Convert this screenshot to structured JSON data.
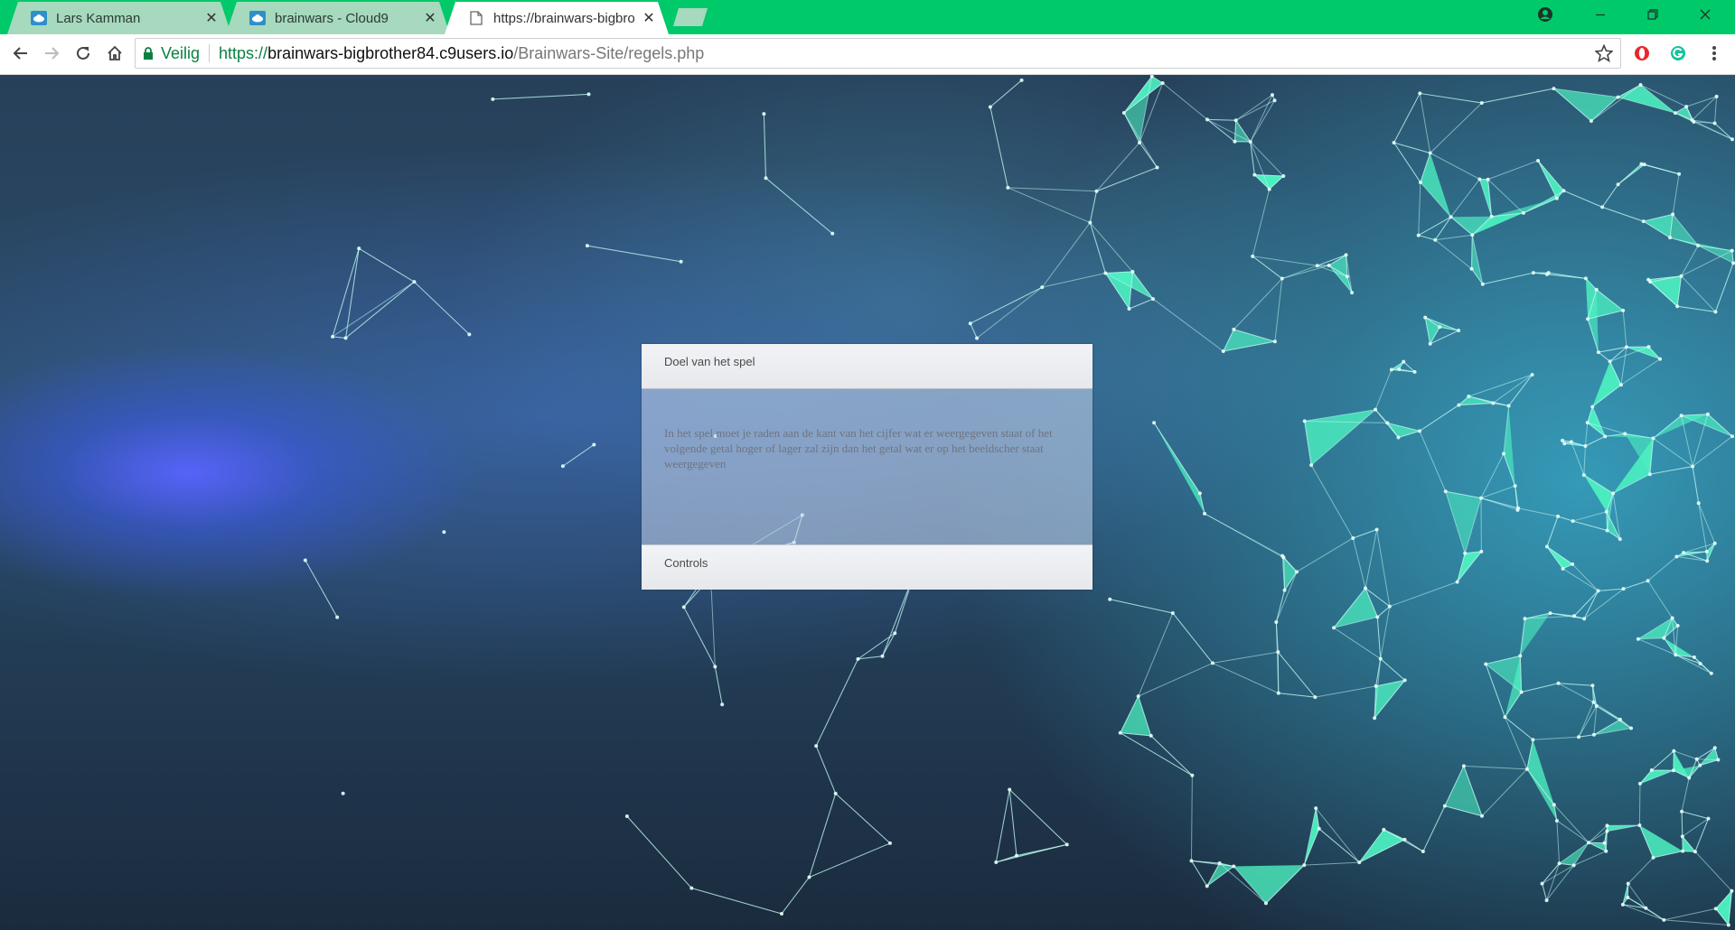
{
  "tabs": [
    {
      "title": "Lars Kamman",
      "icon": "cloud9-icon",
      "active": false
    },
    {
      "title": "brainwars - Cloud9",
      "icon": "cloud9-icon",
      "active": false
    },
    {
      "title": "https://brainwars-bigbro",
      "icon": "page-icon",
      "active": true
    }
  ],
  "toolbar": {
    "secure_label": "Veilig",
    "url_scheme": "https://",
    "url_host": "brainwars-bigbrother84.c9users.io",
    "url_path": "/Brainwars-Site/regels.php"
  },
  "colors": {
    "tab_strip": "#00c96a",
    "accent_network": "#4cf0c0"
  },
  "accordion": {
    "sections": [
      {
        "header": "Doel van het spel",
        "expanded": true,
        "body": "In het spel moet je raden aan de kant van het cijfer wat er weergegeven staat of het volgende getal hoger of lager zal zijn dan het getal wat er op het beeldscher staat weergegeven"
      },
      {
        "header": "Controls",
        "expanded": false,
        "body": ""
      }
    ]
  }
}
